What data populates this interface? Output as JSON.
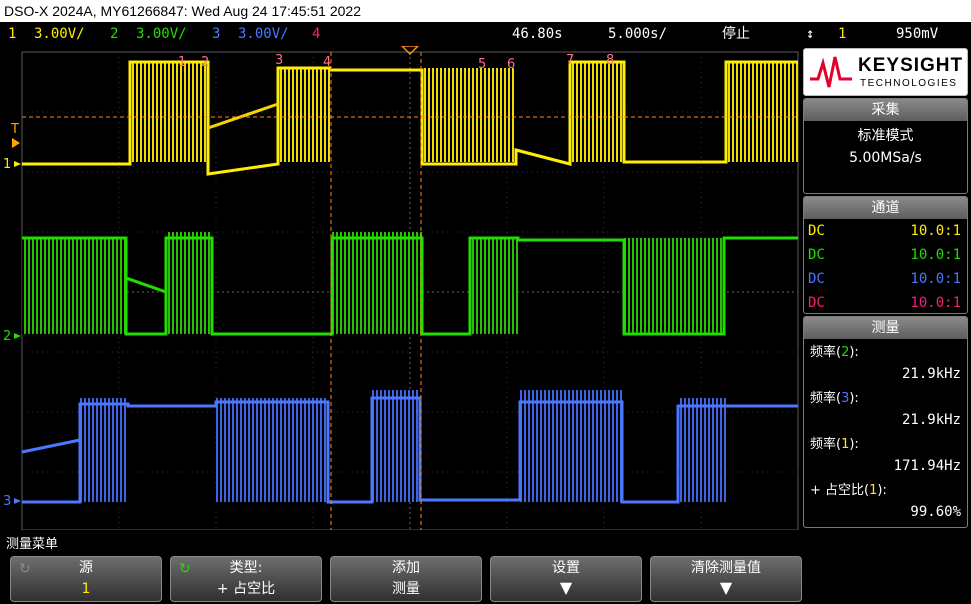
{
  "title": "DSO-X 2024A, MY61266847: Wed Aug 24 17:45:51 2022",
  "status": {
    "ch1_label": "1",
    "ch1_scale": "3.00V/",
    "ch2_label": "2",
    "ch2_scale": "3.00V/",
    "ch3_label": "3",
    "ch3_scale": "3.00V/",
    "ch4_label": "4",
    "time_position": "46.80s",
    "time_scale": "5.000s/",
    "run_state": "停止",
    "trigger_icon": "trigger-edge-icon",
    "trigger_source": "1",
    "trigger_level": "950mV"
  },
  "markers": [
    "1",
    "2",
    "3",
    "4",
    "5",
    "6",
    "7",
    "8"
  ],
  "left_markers": {
    "trigger": "T",
    "ch1": "1",
    "ch2": "2",
    "ch3": "3"
  },
  "colors": {
    "ch1": "#ffee00",
    "ch2": "#22dd00",
    "ch3": "#4a78ff",
    "ch4": "#ff1a7a",
    "cursor": "#ff8a1a",
    "marker": "#ff6f8a"
  },
  "brand": {
    "name": "KEYSIGHT",
    "sub": "TECHNOLOGIES"
  },
  "acquire": {
    "header": "采集",
    "mode": "标准模式",
    "rate": "5.00MSa/s"
  },
  "channels": {
    "header": "通道",
    "rows": [
      {
        "coupling": "DC",
        "ratio": "10.0:1",
        "color": "#ffee00"
      },
      {
        "coupling": "DC",
        "ratio": "10.0:1",
        "color": "#22dd00"
      },
      {
        "coupling": "DC",
        "ratio": "10.0:1",
        "color": "#4a78ff"
      },
      {
        "coupling": "DC",
        "ratio": "10.0:1",
        "color": "#ff1a7a"
      }
    ]
  },
  "measure": {
    "header": "测量",
    "items": [
      {
        "prefix": "频率(",
        "ch": "2",
        "suffix": "):",
        "value": "21.9kHz",
        "color": "#22dd00"
      },
      {
        "prefix": "频率(",
        "ch": "3",
        "suffix": "):",
        "value": "21.9kHz",
        "color": "#4a78ff"
      },
      {
        "prefix": "频率(",
        "ch": "1",
        "suffix": "):",
        "value": "171.94Hz",
        "color": "#ffee00"
      },
      {
        "prefix": "+ 占空比(",
        "ch": "1",
        "suffix": "):",
        "value": "99.60%",
        "color": "#ffee00"
      }
    ]
  },
  "menu": {
    "title": "测量菜单",
    "softkeys": [
      {
        "line1": "源",
        "line2": "1"
      },
      {
        "line1": "类型:",
        "line2": "+ 占空比"
      },
      {
        "line1": "添加",
        "line2": "测量"
      },
      {
        "line1": "设置",
        "line2": "▼"
      },
      {
        "line1": "清除测量值",
        "line2": "▼"
      }
    ]
  }
}
